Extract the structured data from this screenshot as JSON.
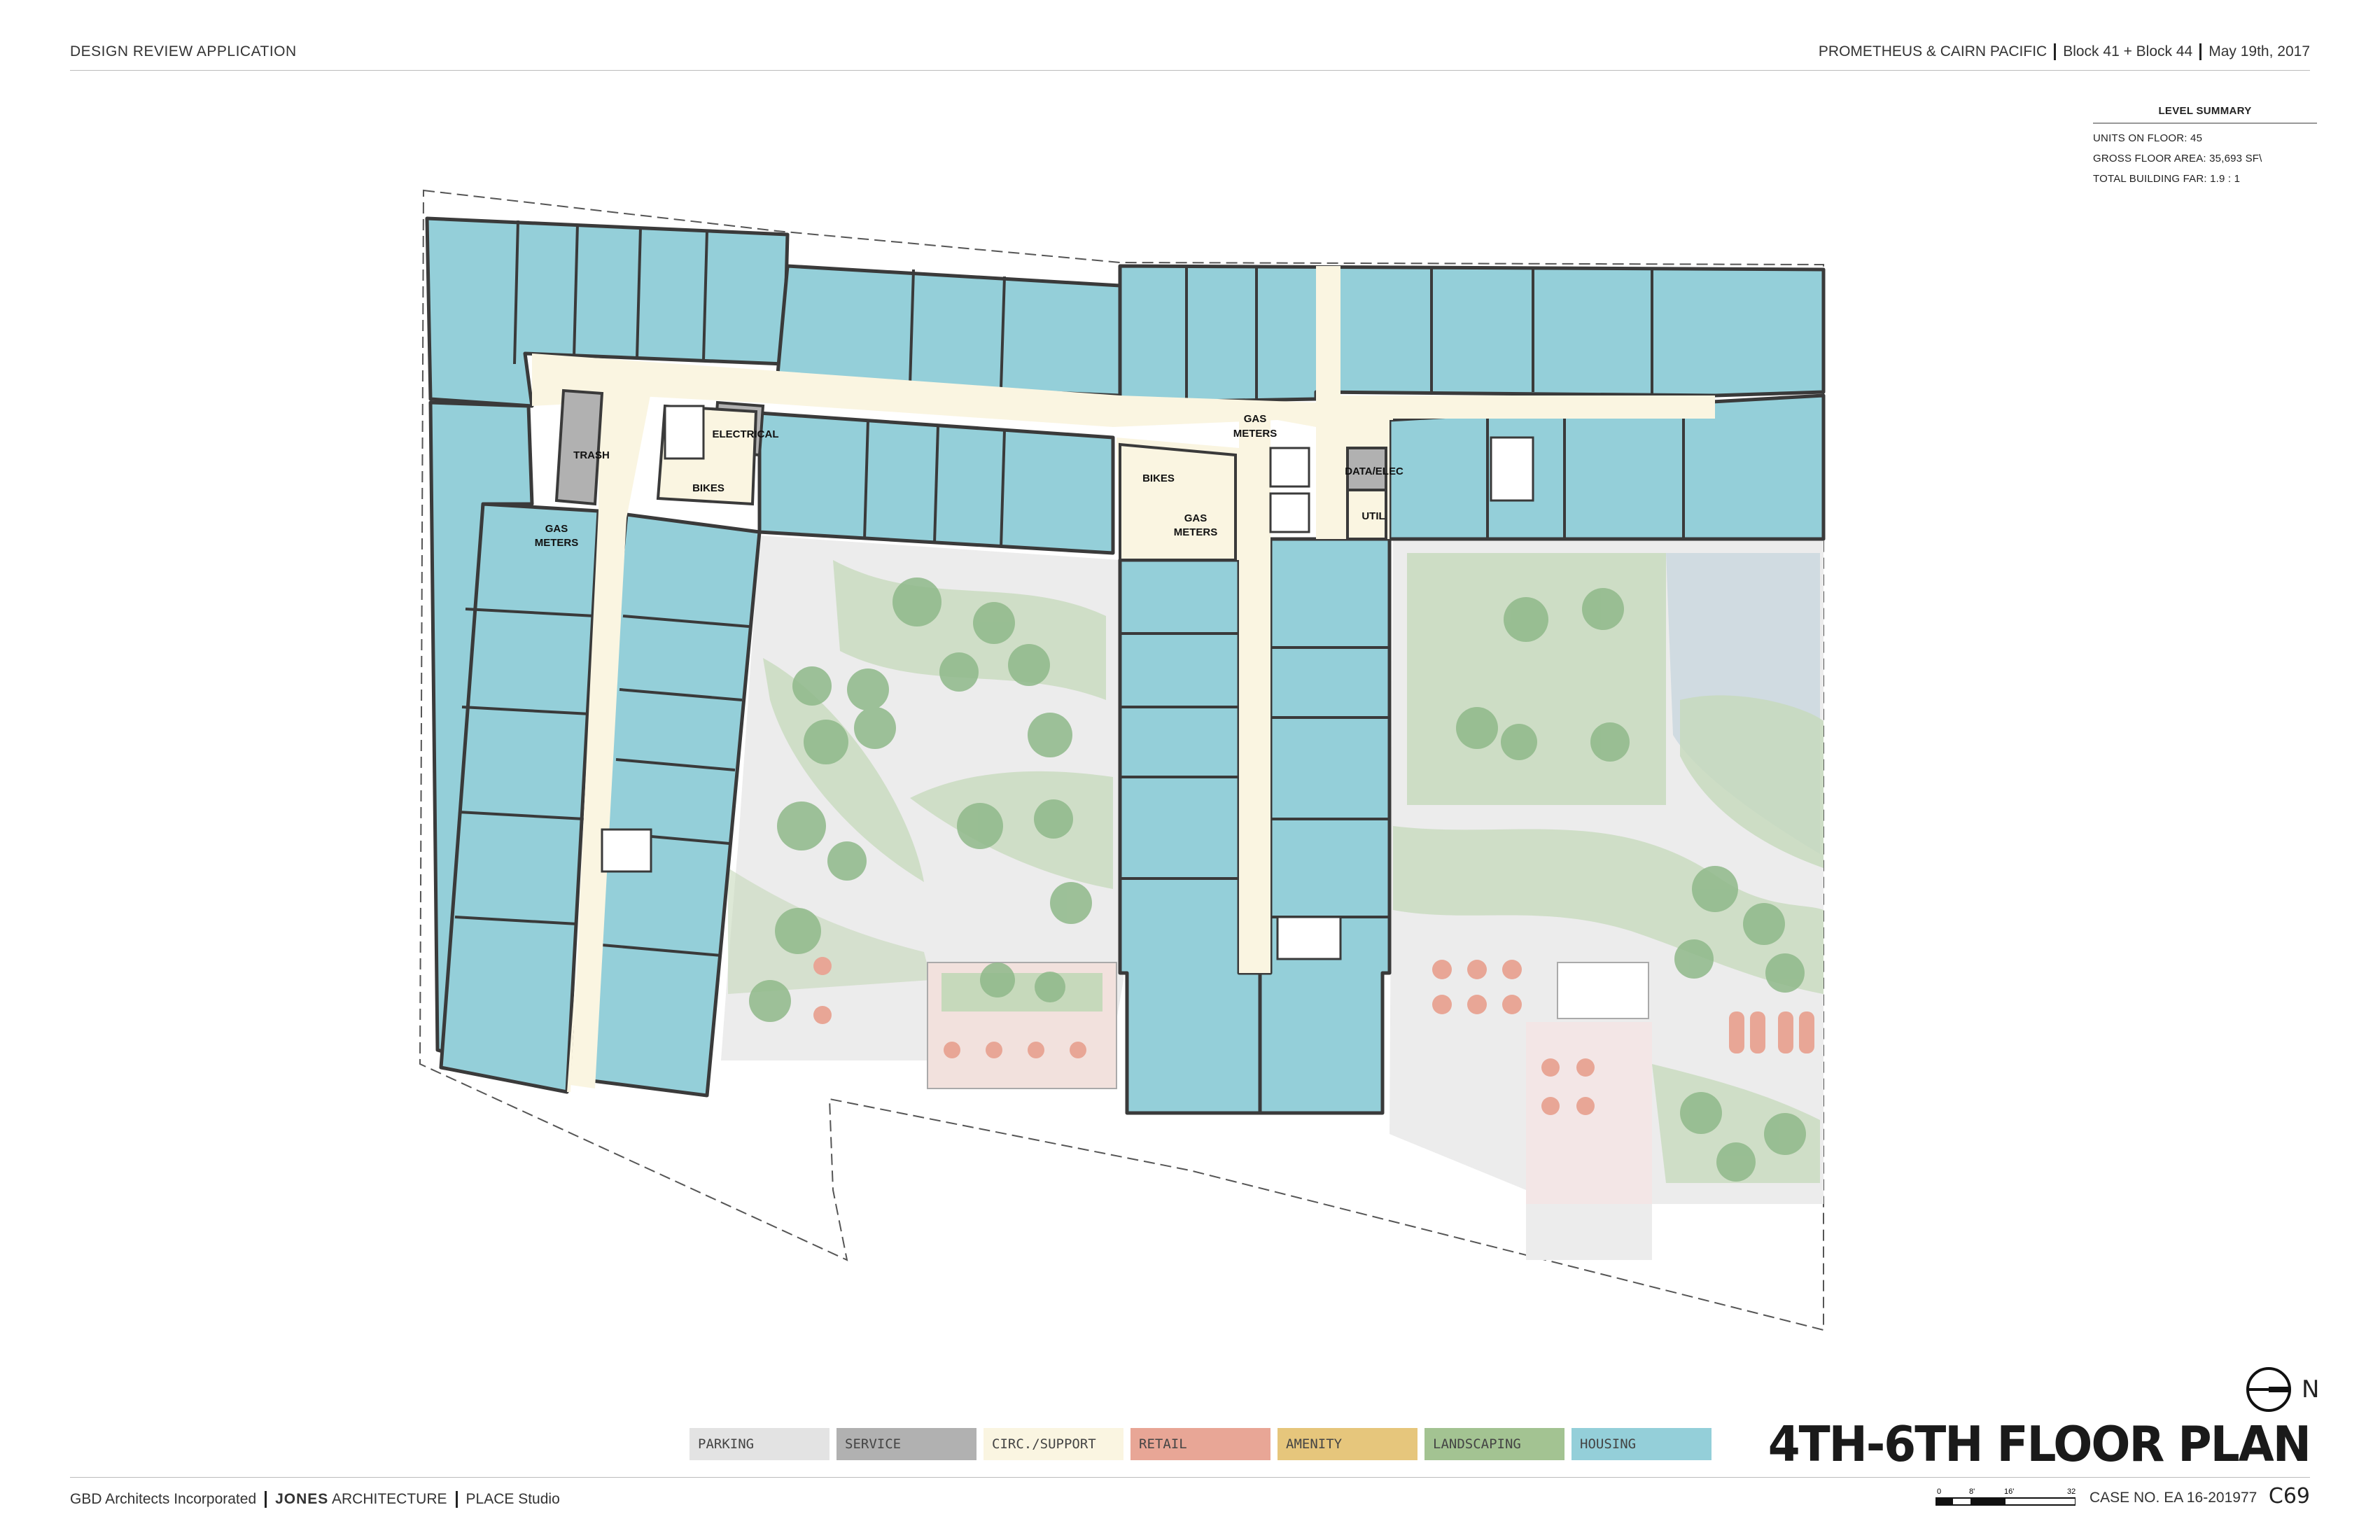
{
  "header": {
    "left": "DESIGN REVIEW APPLICATION",
    "project": "PROMETHEUS  &  CAIRN PACIFIC",
    "blocks": "Block 41 + Block 44",
    "date": "May 19th, 2017"
  },
  "summary": {
    "title": "LEVEL SUMMARY",
    "units": "UNITS ON FLOOR: 45",
    "gfa": "GROSS FLOOR AREA: 35,693 SF\\",
    "far": "TOTAL BUILDING FAR: 1.9 : 1"
  },
  "room_labels": {
    "trash": "TRASH",
    "electrical": "ELECTRICAL",
    "bikes": "BIKES",
    "gas": "GAS",
    "meters": "METERS",
    "data_elec": "DATA/ELEC",
    "util": "UTIL"
  },
  "legend": [
    {
      "label": "PARKING",
      "color": "#e3e3e3"
    },
    {
      "label": "SERVICE",
      "color": "#b1b1b1"
    },
    {
      "label": "CIRC./SUPPORT",
      "color": "#faf5e1"
    },
    {
      "label": "RETAIL",
      "color": "#e8a696"
    },
    {
      "label": "AMENITY",
      "color": "#e6c67c"
    },
    {
      "label": "LANDSCAPING",
      "color": "#a3c392"
    },
    {
      "label": "HOUSING",
      "color": "#94cfd9"
    }
  ],
  "colors": {
    "housing": "#94cfd9",
    "circulation": "#faf5e1",
    "service": "#b1b1b1",
    "wall": "#3a3a3a",
    "courtyard": "#ececec",
    "retail": "#e8a696",
    "landscape": "#a3c392"
  },
  "title": "4TH-6TH FLOOR PLAN",
  "north_label": "N",
  "footer": {
    "firm1": "GBD Architects Incorporated",
    "firm2_bold": "JONES",
    "firm2_rest": " ARCHITECTURE",
    "firm3": "PLACE Studio",
    "case": "CASE NO. EA 16-201977",
    "sheet": "C69"
  },
  "scale_ticks": [
    "0",
    "8'",
    "16'",
    "32'"
  ]
}
